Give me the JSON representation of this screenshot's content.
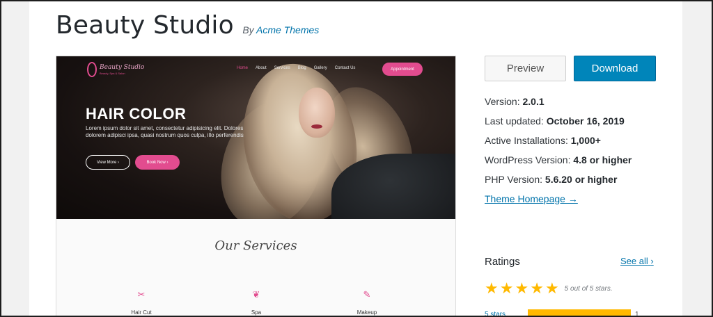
{
  "theme": {
    "name": "Beauty Studio",
    "by_prefix": "By",
    "author": "Acme Themes"
  },
  "preview_site": {
    "logo_name": "Beauty Studio",
    "logo_tagline": "Beauty, Spa & Salon",
    "nav": [
      "Home",
      "About",
      "Services",
      "Blog",
      "Gallery",
      "Contact Us"
    ],
    "appointment_label": "Appointment",
    "hero_title": "HAIR COLOR",
    "hero_text": "Lorem ipsum dolor sit amet, consectetur adipisicing elit. Dolores dolorem adipisci ipsa, quasi nostrum quos culpa, illo perferendis",
    "view_more_label": "View More",
    "book_now_label": "Book Now",
    "services_title": "Our Services",
    "services": [
      {
        "label": "Hair Cut",
        "icon": "scissors-icon",
        "glyph": "✂"
      },
      {
        "label": "Spa",
        "icon": "lips-icon",
        "glyph": "❦"
      },
      {
        "label": "Makeup",
        "icon": "brush-icon",
        "glyph": "✎"
      }
    ]
  },
  "actions": {
    "preview_label": "Preview",
    "download_label": "Download"
  },
  "meta": {
    "version_label": "Version:",
    "version": "2.0.1",
    "updated_label": "Last updated:",
    "updated": "October 16, 2019",
    "installs_label": "Active Installations:",
    "installs": "1,000+",
    "wp_label": "WordPress Version:",
    "wp": "4.8 or higher",
    "php_label": "PHP Version:",
    "php": "5.6.20 or higher",
    "homepage_link": "Theme Homepage →"
  },
  "ratings": {
    "heading": "Ratings",
    "see_all": "See all",
    "stars_text": "5 out of 5 stars.",
    "rating": 5,
    "bars": [
      {
        "label": "5 stars",
        "count": "1",
        "fraction": 1.0
      }
    ]
  },
  "colors": {
    "accent": "#0085ba",
    "link": "#0073aa",
    "star": "#ffb900",
    "brand_pink": "#e24c8f"
  }
}
